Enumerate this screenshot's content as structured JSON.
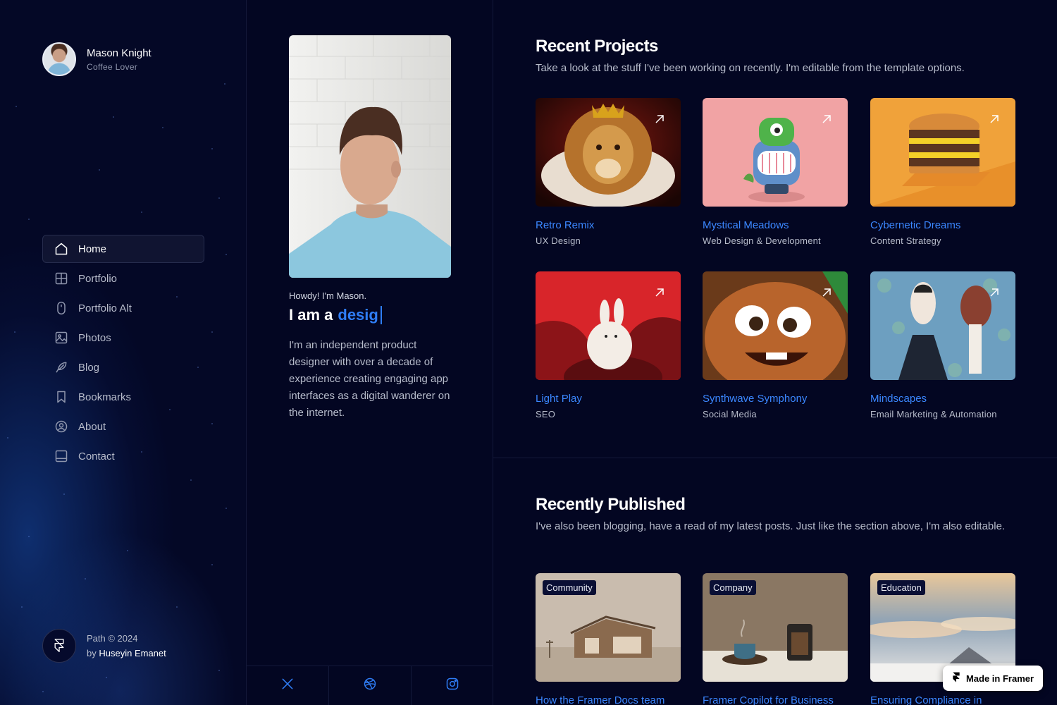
{
  "profile": {
    "name": "Mason Knight",
    "role": "Coffee Lover"
  },
  "nav": [
    {
      "label": "Home",
      "icon": "home-icon",
      "active": true
    },
    {
      "label": "Portfolio",
      "icon": "grid-icon"
    },
    {
      "label": "Portfolio Alt",
      "icon": "mouse-icon"
    },
    {
      "label": "Photos",
      "icon": "image-icon"
    },
    {
      "label": "Blog",
      "icon": "feather-icon"
    },
    {
      "label": "Bookmarks",
      "icon": "bookmark-icon"
    },
    {
      "label": "About",
      "icon": "user-circle-icon"
    },
    {
      "label": "Contact",
      "icon": "inbox-icon"
    }
  ],
  "credit": {
    "line1": "Path © 2024",
    "by": "by",
    "author": "Huseyin Emanet"
  },
  "intro": {
    "greeting": "Howdy! I'm Mason.",
    "tagline_prefix": "I am a",
    "tagline_typed": "desig",
    "bio": "I'm an independent product designer with over a decade of experience creating engaging app interfaces as a digital wanderer on the internet."
  },
  "socials": [
    {
      "icon": "x-twitter-icon"
    },
    {
      "icon": "dribbble-icon"
    },
    {
      "icon": "instagram-icon"
    }
  ],
  "projects": {
    "title": "Recent Projects",
    "description": "Take a look at the stuff I've been working on recently. I'm editable from the template options.",
    "items": [
      {
        "title": "Retro Remix",
        "category": "UX Design"
      },
      {
        "title": "Mystical Meadows",
        "category": "Web Design & Development"
      },
      {
        "title": "Cybernetic Dreams",
        "category": "Content Strategy"
      },
      {
        "title": "Light Play",
        "category": "SEO"
      },
      {
        "title": "Synthwave Symphony",
        "category": "Social Media"
      },
      {
        "title": "Mindscapes",
        "category": "Email Marketing & Automation"
      }
    ]
  },
  "published": {
    "title": "Recently Published",
    "description": "I've also been blogging, have a read of my latest posts. Just like the section above, I'm also editable.",
    "items": [
      {
        "tag": "Community",
        "title": "How the Framer Docs team"
      },
      {
        "tag": "Company",
        "title": "Framer Copilot for Business"
      },
      {
        "tag": "Education",
        "title": "Ensuring Compliance in"
      }
    ]
  },
  "badge": {
    "label": "Made in Framer"
  },
  "colors": {
    "background": "#030622",
    "accent": "#3b87ff",
    "muted": "#b7bccb"
  }
}
